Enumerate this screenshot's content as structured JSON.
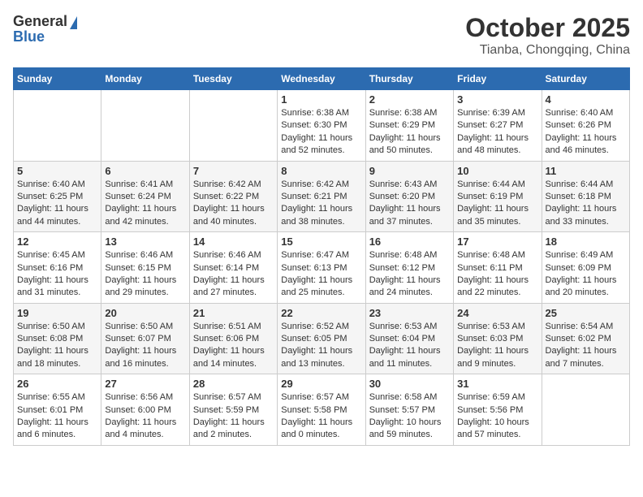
{
  "header": {
    "logo_general": "General",
    "logo_blue": "Blue",
    "month": "October 2025",
    "location": "Tianba, Chongqing, China"
  },
  "weekdays": [
    "Sunday",
    "Monday",
    "Tuesday",
    "Wednesday",
    "Thursday",
    "Friday",
    "Saturday"
  ],
  "weeks": [
    [
      {
        "day": "",
        "info": ""
      },
      {
        "day": "",
        "info": ""
      },
      {
        "day": "",
        "info": ""
      },
      {
        "day": "1",
        "info": "Sunrise: 6:38 AM\nSunset: 6:30 PM\nDaylight: 11 hours and 52 minutes."
      },
      {
        "day": "2",
        "info": "Sunrise: 6:38 AM\nSunset: 6:29 PM\nDaylight: 11 hours and 50 minutes."
      },
      {
        "day": "3",
        "info": "Sunrise: 6:39 AM\nSunset: 6:27 PM\nDaylight: 11 hours and 48 minutes."
      },
      {
        "day": "4",
        "info": "Sunrise: 6:40 AM\nSunset: 6:26 PM\nDaylight: 11 hours and 46 minutes."
      }
    ],
    [
      {
        "day": "5",
        "info": "Sunrise: 6:40 AM\nSunset: 6:25 PM\nDaylight: 11 hours and 44 minutes."
      },
      {
        "day": "6",
        "info": "Sunrise: 6:41 AM\nSunset: 6:24 PM\nDaylight: 11 hours and 42 minutes."
      },
      {
        "day": "7",
        "info": "Sunrise: 6:42 AM\nSunset: 6:22 PM\nDaylight: 11 hours and 40 minutes."
      },
      {
        "day": "8",
        "info": "Sunrise: 6:42 AM\nSunset: 6:21 PM\nDaylight: 11 hours and 38 minutes."
      },
      {
        "day": "9",
        "info": "Sunrise: 6:43 AM\nSunset: 6:20 PM\nDaylight: 11 hours and 37 minutes."
      },
      {
        "day": "10",
        "info": "Sunrise: 6:44 AM\nSunset: 6:19 PM\nDaylight: 11 hours and 35 minutes."
      },
      {
        "day": "11",
        "info": "Sunrise: 6:44 AM\nSunset: 6:18 PM\nDaylight: 11 hours and 33 minutes."
      }
    ],
    [
      {
        "day": "12",
        "info": "Sunrise: 6:45 AM\nSunset: 6:16 PM\nDaylight: 11 hours and 31 minutes."
      },
      {
        "day": "13",
        "info": "Sunrise: 6:46 AM\nSunset: 6:15 PM\nDaylight: 11 hours and 29 minutes."
      },
      {
        "day": "14",
        "info": "Sunrise: 6:46 AM\nSunset: 6:14 PM\nDaylight: 11 hours and 27 minutes."
      },
      {
        "day": "15",
        "info": "Sunrise: 6:47 AM\nSunset: 6:13 PM\nDaylight: 11 hours and 25 minutes."
      },
      {
        "day": "16",
        "info": "Sunrise: 6:48 AM\nSunset: 6:12 PM\nDaylight: 11 hours and 24 minutes."
      },
      {
        "day": "17",
        "info": "Sunrise: 6:48 AM\nSunset: 6:11 PM\nDaylight: 11 hours and 22 minutes."
      },
      {
        "day": "18",
        "info": "Sunrise: 6:49 AM\nSunset: 6:09 PM\nDaylight: 11 hours and 20 minutes."
      }
    ],
    [
      {
        "day": "19",
        "info": "Sunrise: 6:50 AM\nSunset: 6:08 PM\nDaylight: 11 hours and 18 minutes."
      },
      {
        "day": "20",
        "info": "Sunrise: 6:50 AM\nSunset: 6:07 PM\nDaylight: 11 hours and 16 minutes."
      },
      {
        "day": "21",
        "info": "Sunrise: 6:51 AM\nSunset: 6:06 PM\nDaylight: 11 hours and 14 minutes."
      },
      {
        "day": "22",
        "info": "Sunrise: 6:52 AM\nSunset: 6:05 PM\nDaylight: 11 hours and 13 minutes."
      },
      {
        "day": "23",
        "info": "Sunrise: 6:53 AM\nSunset: 6:04 PM\nDaylight: 11 hours and 11 minutes."
      },
      {
        "day": "24",
        "info": "Sunrise: 6:53 AM\nSunset: 6:03 PM\nDaylight: 11 hours and 9 minutes."
      },
      {
        "day": "25",
        "info": "Sunrise: 6:54 AM\nSunset: 6:02 PM\nDaylight: 11 hours and 7 minutes."
      }
    ],
    [
      {
        "day": "26",
        "info": "Sunrise: 6:55 AM\nSunset: 6:01 PM\nDaylight: 11 hours and 6 minutes."
      },
      {
        "day": "27",
        "info": "Sunrise: 6:56 AM\nSunset: 6:00 PM\nDaylight: 11 hours and 4 minutes."
      },
      {
        "day": "28",
        "info": "Sunrise: 6:57 AM\nSunset: 5:59 PM\nDaylight: 11 hours and 2 minutes."
      },
      {
        "day": "29",
        "info": "Sunrise: 6:57 AM\nSunset: 5:58 PM\nDaylight: 11 hours and 0 minutes."
      },
      {
        "day": "30",
        "info": "Sunrise: 6:58 AM\nSunset: 5:57 PM\nDaylight: 10 hours and 59 minutes."
      },
      {
        "day": "31",
        "info": "Sunrise: 6:59 AM\nSunset: 5:56 PM\nDaylight: 10 hours and 57 minutes."
      },
      {
        "day": "",
        "info": ""
      }
    ]
  ]
}
